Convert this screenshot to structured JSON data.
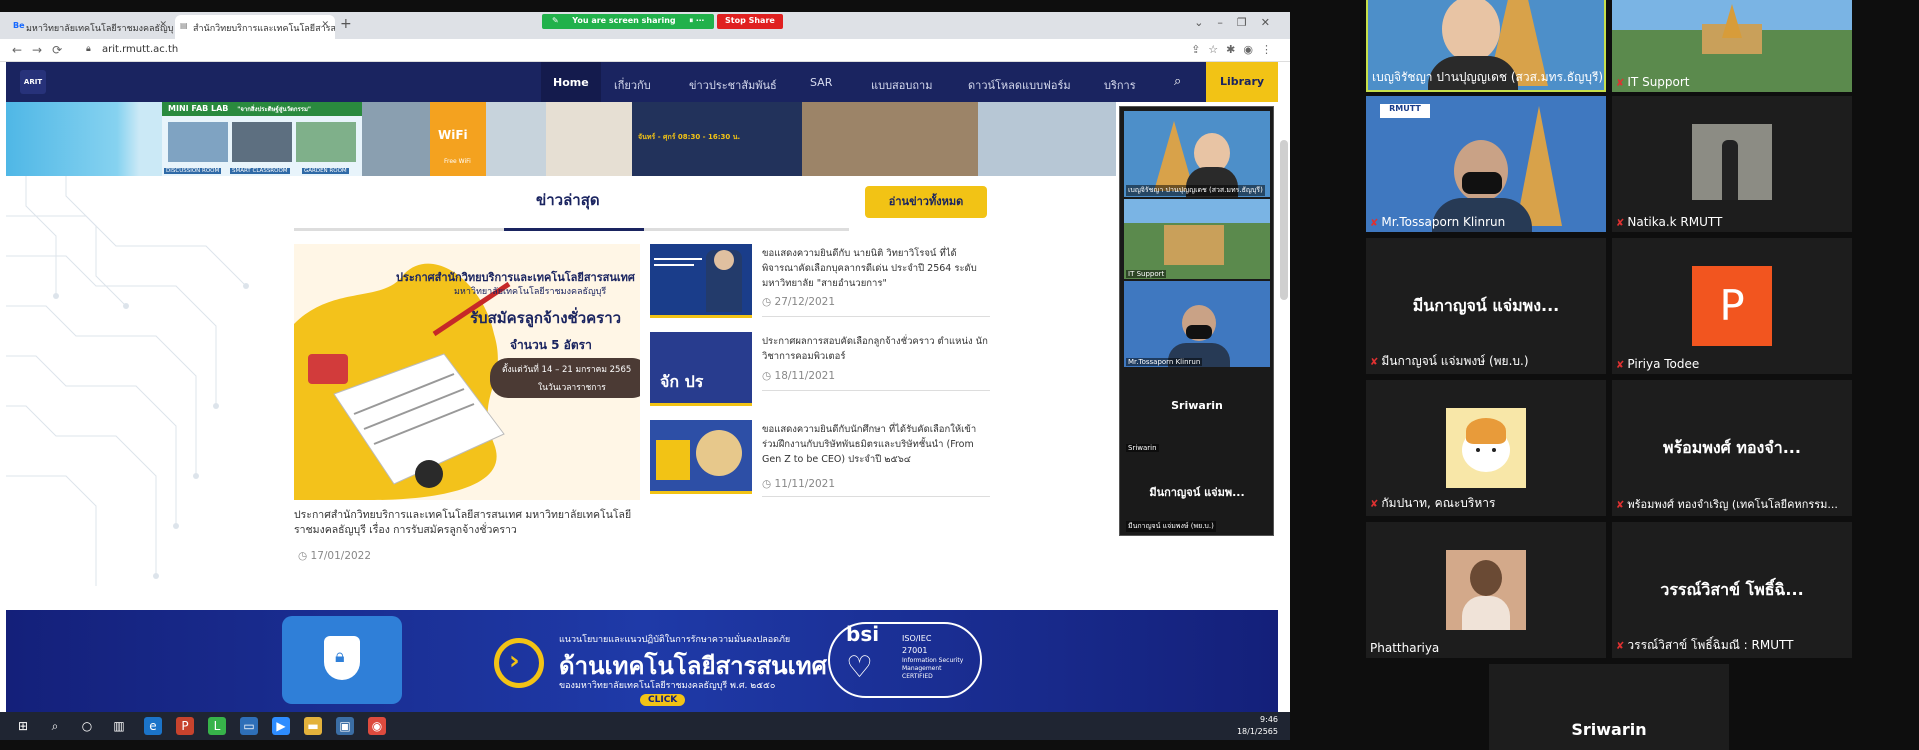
{
  "browser": {
    "tabs": [
      {
        "favicon": "Be",
        "title": "มหาวิทยาลัยเทคโนโลยีราชมงคลธัญบุรี"
      },
      {
        "favicon": "doc-icon",
        "title": "สำนักวิทยบริการและเทคโนโลยีสารสนเทศ"
      }
    ],
    "new_tab": "+",
    "url": "arit.rmutt.ac.th",
    "share_text": "You are screen sharing",
    "stop_share": "Stop Share"
  },
  "site": {
    "logo": "ARIT",
    "menu": [
      "Home",
      "เกี่ยวกับ",
      "ข่าวประชาสัมพันธ์",
      "SAR",
      "แบบสอบถาม",
      "ดาวน์โหลดแบบฟอร์ม",
      "บริการ"
    ],
    "library": "Library",
    "banner": {
      "fablab": "MINI FAB LAB",
      "fablab_sub": "\"จากสิ่งประดิษฐ์สู่นวัตกรรม\"",
      "labels": [
        "DISCUSSION ROOM",
        "SMART CLASSROOM",
        "GARDEN ROOM",
        "Free WiFi"
      ],
      "hours": "จันทร์ - ศุกร์ 08:30 - 16:30 น."
    },
    "news": {
      "heading": "ข่าวล่าสุด",
      "all_button": "อ่านข่าวทั้งหมด",
      "main": {
        "image_title": "ประกาศสำนักวิทยบริการและเทคโนโลยีสารสนเทศ",
        "image_sub": "มหาวิทยาลัยเทคโนโลยีราชมงคลธัญบุรี",
        "image_headline": "รับสมัครลูกจ้างชั่วคราว",
        "image_count": "จำนวน 5 อัตรา",
        "image_dates": "ตั้งแต่วันที่ 14 – 21 มกราคม 2565",
        "image_time": "ในวันเวลาราชการ",
        "caption": "ประกาศสำนักวิทยบริการและเทคโนโลยีสารสนเทศ มหาวิทยาลัยเทคโนโลยีราชมงคลธัญบุรี เรื่อง การรับสมัครลูกจ้างชั่วคราว",
        "date": "17/01/2022"
      },
      "side": [
        {
          "text": "ขอแสดงความยินดีกับ นายนิติ วิทยาวิโรจน์ ที่ได้พิจารณาคัดเลือกบุคลากรดีเด่น ประจำปี 2564 ระดับมหาวิทยาลัย \"สายอำนวยการ\"",
          "date": "27/12/2021"
        },
        {
          "text": "ประกาศผลการสอบคัดเลือกลูกจ้างชั่วคราว ตำแหน่ง นักวิชาการคอมพิวเตอร์",
          "date": "18/11/2021"
        },
        {
          "text": "ขอแสดงความยินดีกับนักศึกษา ที่ได้รับคัดเลือกให้เข้าร่วมฝึกงานกับบริษัทพันธมิตรและบริษัทชั้นนำ (From Gen Z to be CEO) ประจำปี ๒๕๖๔",
          "date": "11/11/2021"
        }
      ]
    },
    "bottom_banner": {
      "line1": "แนวนโยบายและแนวปฏิบัติในการรักษาความมั่นคงปลอดภัย",
      "line2": "ด้านเทคโนโลยีสารสนเทศ",
      "line3": "ของมหาวิทยาลัยเทคโนโลยีราชมงคลธัญบุรี พ.ศ. ๒๕๕๐",
      "click": "CLICK",
      "bsi": "bsi",
      "iso": "ISO/IEC",
      "iso_num": "27001",
      "iso_desc1": "Information Security",
      "iso_desc2": "Management",
      "iso_desc3": "CERTIFIED"
    }
  },
  "taskbar": {
    "time": "9:46",
    "date": "18/1/2565"
  },
  "self_view": [
    {
      "label": "เบญจิรัชญา ปานปุญญเดช (สวส.มทร.ธัญบุรี)"
    },
    {
      "label": "IT Support"
    },
    {
      "label": "Mr.Tossaporn Klinrun"
    },
    {
      "big": "Sriwarin",
      "label": "Sriwarin"
    },
    {
      "big": "มีนกาญจน์ แจ่มพ...",
      "label": "มีนกาญจน์ แจ่มพงษ์ (พย.บ.)"
    }
  ],
  "gallery": [
    {
      "name": "เบญจิรัชญา ปานปุญญเดช (สวส.มทร.ธัญบุรี)",
      "muted": false,
      "type": "video-woman"
    },
    {
      "name": "IT Support",
      "muted": true,
      "type": "video-campus"
    },
    {
      "name": "Mr.Tossaporn Klinrun",
      "muted": true,
      "type": "video-man"
    },
    {
      "name": "Natika.k RMUTT",
      "muted": true,
      "type": "photo-suit"
    },
    {
      "name": "มีนกาญจน์ แจ่มพงษ์ (พย.บ.)",
      "muted": true,
      "big": "มีนกาญจน์ แจ่มพง..."
    },
    {
      "name": "Piriya Todee",
      "muted": true,
      "initial": "P"
    },
    {
      "name": "กัมปนาท, คณะบริหาร",
      "muted": true,
      "type": "photo-cat"
    },
    {
      "name": "พร้อมพงศ์ ทองจำเริญ (เทคโนโลยีคหกรรม...",
      "muted": true,
      "big": "พร้อมพงศ์ ทองจำ..."
    },
    {
      "name": "Phatthariya",
      "muted": false,
      "type": "photo-person"
    },
    {
      "name": "วรรณ์วิสาข์ โพธิ์ฉิมณี : RMUTT",
      "muted": true,
      "big": "วรรณ์วิสาข์ โพธิ์ฉิ..."
    },
    {
      "name": "",
      "muted": false,
      "big": "Sriwarin"
    }
  ],
  "colors": {
    "navy": "#1a2460",
    "yellow": "#f2c315",
    "zoom_bg": "#0e0e0e",
    "tile_bg": "#1d1d1d",
    "muted_red": "#e03131",
    "highlight": "#c7e04b"
  }
}
